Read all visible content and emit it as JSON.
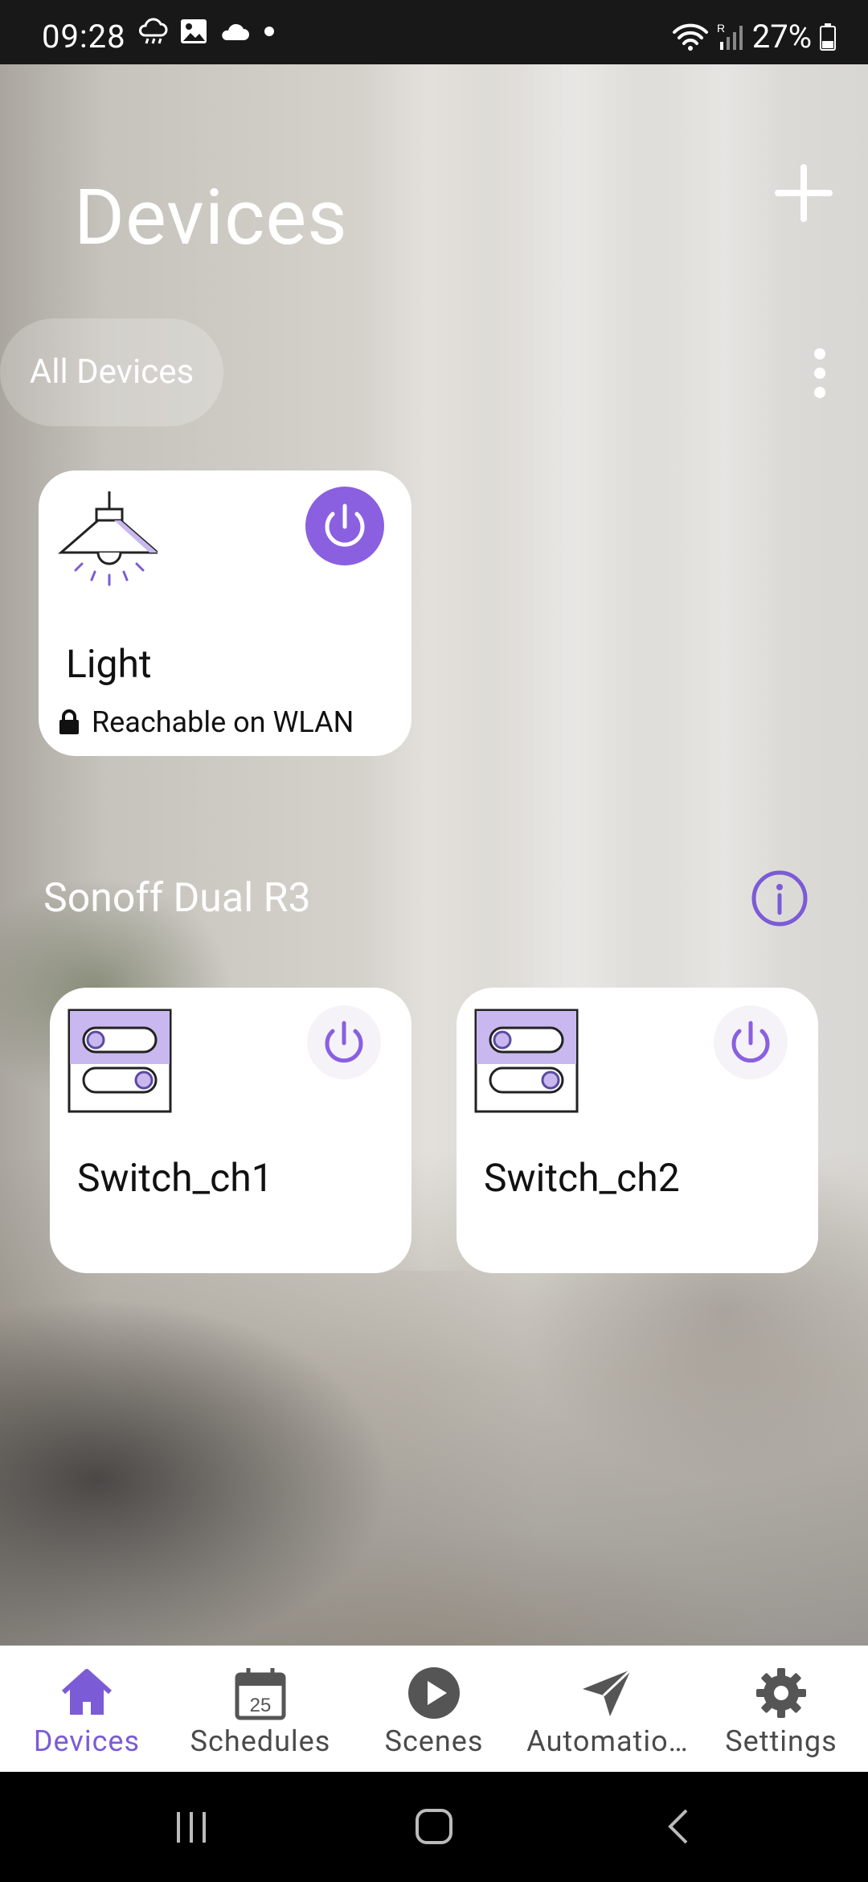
{
  "status_bar": {
    "time": "09:28",
    "battery": "27%"
  },
  "header": {
    "title": "Devices"
  },
  "filter": {
    "label": "All Devices"
  },
  "light_card": {
    "name": "Light",
    "status": "Reachable on WLAN",
    "power_color": "#8a5fe0"
  },
  "group": {
    "name": "Sonoff Dual R3",
    "switches": [
      {
        "name": "Switch_ch1"
      },
      {
        "name": "Switch_ch2"
      }
    ]
  },
  "bottom_nav": {
    "items": [
      {
        "label": "Devices",
        "icon": "home-icon",
        "active": true
      },
      {
        "label": "Schedules",
        "icon": "calendar-icon",
        "calendar_day": "25"
      },
      {
        "label": "Scenes",
        "icon": "play-icon"
      },
      {
        "label": "Automatio…",
        "icon": "send-icon"
      },
      {
        "label": "Settings",
        "icon": "gear-icon"
      }
    ]
  },
  "colors": {
    "accent": "#8a5fe0",
    "active_nav": "#7b5bd6",
    "icon_gray": "#555555"
  }
}
